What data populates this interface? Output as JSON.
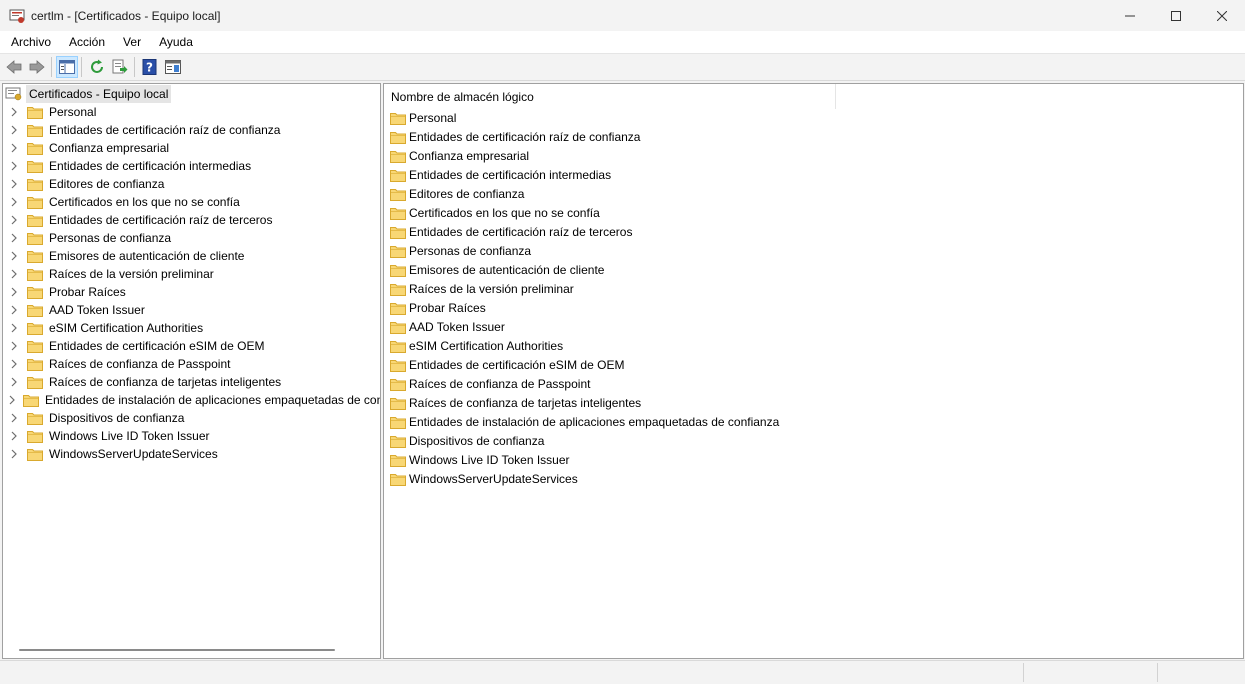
{
  "window": {
    "title": "certlm - [Certificados - Equipo local]",
    "app_icon": "certificate-icon",
    "controls": [
      "minimize-icon",
      "maximize-icon",
      "close-icon"
    ]
  },
  "menu": [
    "Archivo",
    "Acción",
    "Ver",
    "Ayuda"
  ],
  "toolbar": {
    "buttons": [
      "back-arrow-icon",
      "forward-arrow-icon",
      "show-hide-tree-icon",
      "refresh-icon",
      "export-list-icon",
      "help-icon",
      "properties-pane-icon"
    ]
  },
  "tree": {
    "root": "Certificados - Equipo local",
    "items": [
      "Personal",
      "Entidades de certificación raíz de confianza",
      "Confianza empresarial",
      "Entidades de certificación intermedias",
      "Editores de confianza",
      "Certificados en los que no se confía",
      "Entidades de certificación raíz de terceros",
      "Personas de confianza",
      "Emisores de autenticación de cliente",
      "Raíces de la versión preliminar",
      "Probar Raíces",
      "AAD Token Issuer",
      "eSIM Certification Authorities",
      "Entidades de certificación eSIM de OEM",
      "Raíces de confianza de Passpoint",
      "Raíces de confianza de tarjetas inteligentes",
      "Entidades de instalación de aplicaciones empaquetadas de confianza",
      "Dispositivos de confianza",
      "Windows Live ID Token Issuer",
      "WindowsServerUpdateServices"
    ]
  },
  "list": {
    "column_header": "Nombre de almacén lógico",
    "items": [
      "Personal",
      "Entidades de certificación raíz de confianza",
      "Confianza empresarial",
      "Entidades de certificación intermedias",
      "Editores de confianza",
      "Certificados en los que no se confía",
      "Entidades de certificación raíz de terceros",
      "Personas de confianza",
      "Emisores de autenticación de cliente",
      "Raíces de la versión preliminar",
      "Probar Raíces",
      "AAD Token Issuer",
      "eSIM Certification Authorities",
      "Entidades de certificación eSIM de OEM",
      "Raíces de confianza de Passpoint",
      "Raíces de confianza de tarjetas inteligentes",
      "Entidades de instalación de aplicaciones empaquetadas de confianza",
      "Dispositivos de confianza",
      "Windows Live ID Token Issuer",
      "WindowsServerUpdateServices"
    ]
  },
  "colors": {
    "folder_fill": "#f8d775",
    "folder_stroke": "#d9a92e",
    "selection_bg": "#e5e5e5"
  }
}
